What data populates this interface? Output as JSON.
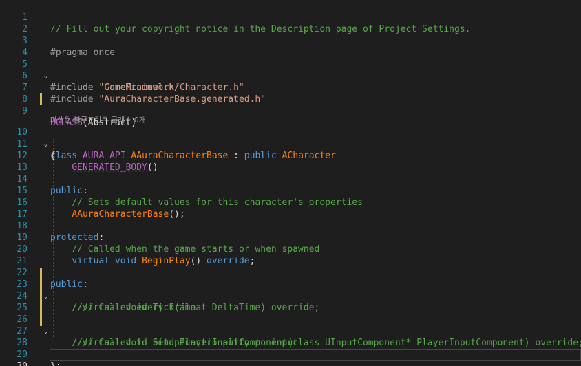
{
  "editor": {
    "file_language": "C++",
    "active_line": "30",
    "colors": {
      "background": "#1e1e1e",
      "comment": "#57a64a",
      "keyword": "#569cd6",
      "macro": "#bd63c5",
      "string": "#d69d85",
      "type": "#4ec9b0",
      "function": "#ff8000",
      "line_number": "#2b91af",
      "change_marker": "#d7ba5b"
    },
    "line_numbers": [
      "1",
      "2",
      "3",
      "4",
      "5",
      "6",
      "7",
      "8",
      "9",
      "10",
      "11",
      "12",
      "13",
      "14",
      "15",
      "16",
      "17",
      "18",
      "19",
      "20",
      "21",
      "22",
      "23",
      "24",
      "25",
      "26",
      "27",
      "28",
      "29",
      "30"
    ],
    "codelens": "파생된 블루프린트 클래스 0개",
    "lines": {
      "l1": "// Fill out your copyright notice in the Description page of Project Settings.",
      "l3": "#pragma once",
      "l5_directive": "#include",
      "l5_path": "\"CoreMinimal.h\"",
      "l6_directive": "#include",
      "l6_path": "\"GameFramework/Character.h\"",
      "l7_directive": "#include",
      "l7_path": "\"AuraCharacterBase.generated.h\"",
      "l9_macro": "UCLASS",
      "l9_args": "(Abstract)",
      "l10_class": "class",
      "l10_api": "AURA_API",
      "l10_name": "AAuraCharacterBase",
      "l10_colon": " : ",
      "l10_public": "public",
      "l10_base": "ACharacter",
      "l11": "{",
      "l12_macro": "GENERATED_BODY",
      "l12_parens": "()",
      "l14": "public",
      "l14_colon": ":",
      "l15": "// Sets default values for this character's properties",
      "l16_fn": "AAuraCharacterBase",
      "l16_rest": "();",
      "l18": "protected",
      "l18_colon": ":",
      "l19": "// Called when the game starts or when spawned",
      "l20_virtual": "virtual",
      "l20_void": "void",
      "l20_fn": "BeginPlay",
      "l20_parens": "()",
      "l20_override": "override",
      "l20_end": ";",
      "l22": "public",
      "l22_colon": ":",
      "l23": "//// Called every frame",
      "l24": "//virtual void Tick(float DeltaTime) override;",
      "l26": "//// Called to bind functionality to input",
      "l27": "//virtual void SetupPlayerInputComponent(class UInputComponent* PlayerInputComponent) override;",
      "l29": "};"
    },
    "fold_icon": "chevron-down-icon"
  }
}
